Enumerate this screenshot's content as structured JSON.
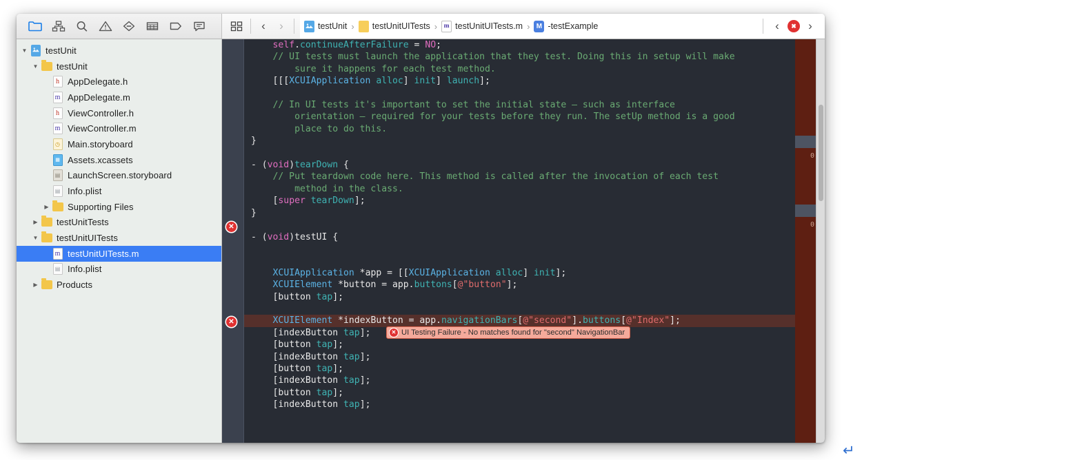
{
  "navigator_toolbar": {
    "icons": [
      {
        "name": "project-navigator-icon",
        "glyph": "folder",
        "active": true
      },
      {
        "name": "source-control-navigator-icon",
        "glyph": "hierarchy",
        "active": false
      },
      {
        "name": "find-navigator-icon",
        "glyph": "search",
        "active": false
      },
      {
        "name": "issue-navigator-icon",
        "glyph": "warning-triangle",
        "active": false
      },
      {
        "name": "test-navigator-icon",
        "glyph": "diamond-minus",
        "active": false
      },
      {
        "name": "debug-navigator-icon",
        "glyph": "table",
        "active": false
      },
      {
        "name": "breakpoint-navigator-icon",
        "glyph": "tag",
        "active": false
      },
      {
        "name": "report-navigator-icon",
        "glyph": "speech-bubble",
        "active": false
      }
    ]
  },
  "editor_toolbar": {
    "jump_icon": "related-items-icon",
    "back_label": "‹",
    "forward_label": "›",
    "breadcrumb": [
      {
        "label": "testUnit",
        "icon": "project-icon"
      },
      {
        "label": "testUnitUITests",
        "icon": "folder-icon"
      },
      {
        "label": "testUnitUITests.m",
        "icon": "objc-implementation-icon"
      },
      {
        "label": "-testExample",
        "icon": "method-icon"
      }
    ],
    "separator": "›",
    "issue_prev_label": "‹",
    "issue_next_label": "›",
    "issue_badge_label": "✖"
  },
  "navigator": {
    "items": [
      {
        "label": "testUnit",
        "indent": 0,
        "twisty": "down",
        "icon": "project",
        "selected": false
      },
      {
        "label": "testUnit",
        "indent": 1,
        "twisty": "down",
        "icon": "folder",
        "selected": false
      },
      {
        "label": "AppDelegate.h",
        "indent": 2,
        "twisty": "",
        "icon": "h",
        "selected": false
      },
      {
        "label": "AppDelegate.m",
        "indent": 2,
        "twisty": "",
        "icon": "m",
        "selected": false
      },
      {
        "label": "ViewController.h",
        "indent": 2,
        "twisty": "",
        "icon": "h",
        "selected": false
      },
      {
        "label": "ViewController.m",
        "indent": 2,
        "twisty": "",
        "icon": "m",
        "selected": false
      },
      {
        "label": "Main.storyboard",
        "indent": 2,
        "twisty": "",
        "icon": "storyboard",
        "selected": false
      },
      {
        "label": "Assets.xcassets",
        "indent": 2,
        "twisty": "",
        "icon": "assets",
        "selected": false
      },
      {
        "label": "LaunchScreen.storyboard",
        "indent": 2,
        "twisty": "",
        "icon": "launchscreen",
        "selected": false
      },
      {
        "label": "Info.plist",
        "indent": 2,
        "twisty": "",
        "icon": "plist",
        "selected": false
      },
      {
        "label": "Supporting Files",
        "indent": 2,
        "twisty": "right",
        "icon": "folder",
        "selected": false
      },
      {
        "label": "testUnitTests",
        "indent": 1,
        "twisty": "right",
        "icon": "folder",
        "selected": false
      },
      {
        "label": "testUnitUITests",
        "indent": 1,
        "twisty": "down",
        "icon": "folder",
        "selected": false
      },
      {
        "label": "testUnitUITests.m",
        "indent": 2,
        "twisty": "",
        "icon": "m",
        "selected": true
      },
      {
        "label": "Info.plist",
        "indent": 2,
        "twisty": "",
        "icon": "plist",
        "selected": false
      },
      {
        "label": "Products",
        "indent": 1,
        "twisty": "right",
        "icon": "folder",
        "selected": false
      }
    ]
  },
  "editor": {
    "code_lines": [
      "    self.continueAfterFailure = NO;",
      "    // UI tests must launch the application that they test. Doing this in setup will make",
      "        sure it happens for each test method.",
      "    [[[XCUIApplication alloc] init] launch];",
      "",
      "    // In UI tests it's important to set the initial state — such as interface",
      "        orientation — required for your tests before they run. The setUp method is a good",
      "        place to do this.",
      "}",
      "",
      "- (void)tearDown {",
      "    // Put teardown code here. This method is called after the invocation of each test",
      "        method in the class.",
      "    [super tearDown];",
      "}",
      "",
      "- (void)testUI {",
      "",
      "",
      "    XCUIApplication *app = [[XCUIApplication alloc] init];",
      "    XCUIElement *button = app.buttons[@\"button\"];",
      "    [button tap];",
      "",
      "    XCUIElement *indexButton = app.navigationBars[@\"second\"].buttons[@\"Index\"];",
      "    [indexButton tap];",
      "    [button tap];",
      "    [indexButton tap];",
      "    [button tap];",
      "    [indexButton tap];",
      "    [button tap];",
      "    [indexButton tap];",
      "",
      "",
      "",
      "}"
    ],
    "error_bubble": {
      "text": "UI Testing Failure - No matches found for \"second\" NavigationBar",
      "icon": "error-badge-icon"
    },
    "gutter_markers": [
      "error-marker",
      "error-marker"
    ],
    "change_bar_numbers": [
      "0",
      "0"
    ]
  },
  "page": {
    "return_glyph": "↵"
  },
  "colors": {
    "accent": "#3a7df4",
    "error": "#e03131",
    "error_bubble_bg": "#f5aa9b",
    "editor_bg": "#282c34",
    "gutter_bg": "#3b414e",
    "changebar_bg": "#5e1f12",
    "navigator_bg": "#eaeeeb"
  }
}
